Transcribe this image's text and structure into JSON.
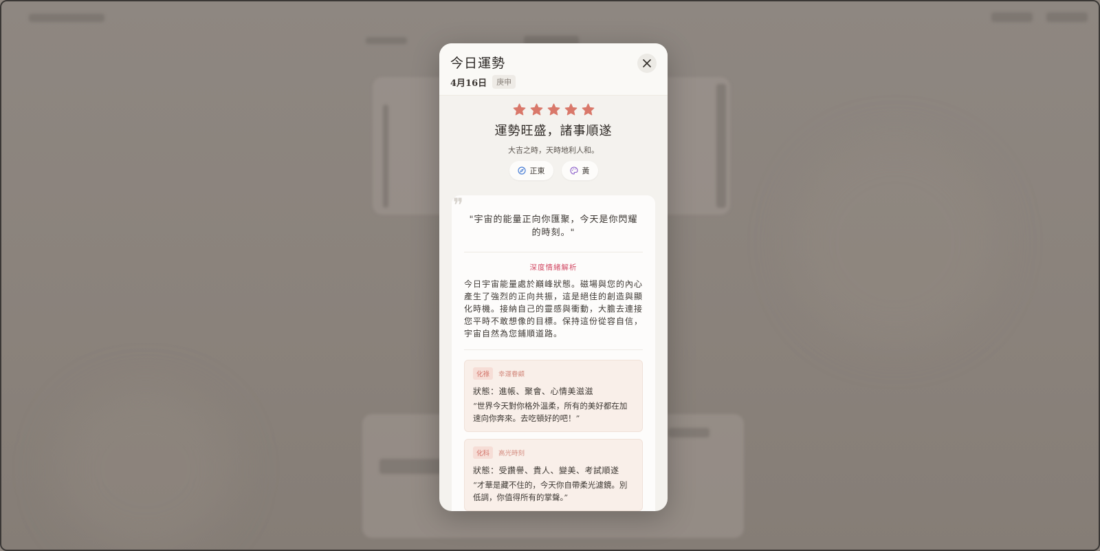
{
  "modal": {
    "title": "今日運勢",
    "date": "4月16日",
    "ganzhi": "庚申",
    "rating": 5,
    "star_color": "#d9786a",
    "headline": "運勢旺盛，諸事順遂",
    "subheadline": "大吉之時，天時地利人和。",
    "chips": [
      {
        "icon": "compass-icon",
        "label": "正東"
      },
      {
        "icon": "palette-icon",
        "label": "黃"
      }
    ]
  },
  "card": {
    "quote": "\"宇宙的能量正向你匯聚，今天是你閃耀的時刻。\"",
    "analysis_title": "深度情緒解析",
    "analysis_text": "今日宇宙能量處於巔峰狀態。磁場與您的內心產生了強烈的正向共振，這是絕佳的創造與顯化時機。接納自己的靈感與衝動，大膽去連接您平時不敢想像的目標。保持這份從容自信，宇宙自然為您鋪順道路。",
    "states": [
      {
        "tag": "化祿",
        "subtitle": "幸運眷顧",
        "state": "狀態：進帳、聚會、心情美滋滋",
        "quote": "“世界今天對你格外溫柔，所有的美好都在加速向你奔來。去吃頓好的吧！”"
      },
      {
        "tag": "化科",
        "subtitle": "高光時刻",
        "state": "狀態：受讚譽、貴人、變美、考試順遂",
        "quote": "“才華是藏不住的，今天你自帶柔光濾鏡。別低調，你值得所有的掌聲。”"
      }
    ]
  }
}
